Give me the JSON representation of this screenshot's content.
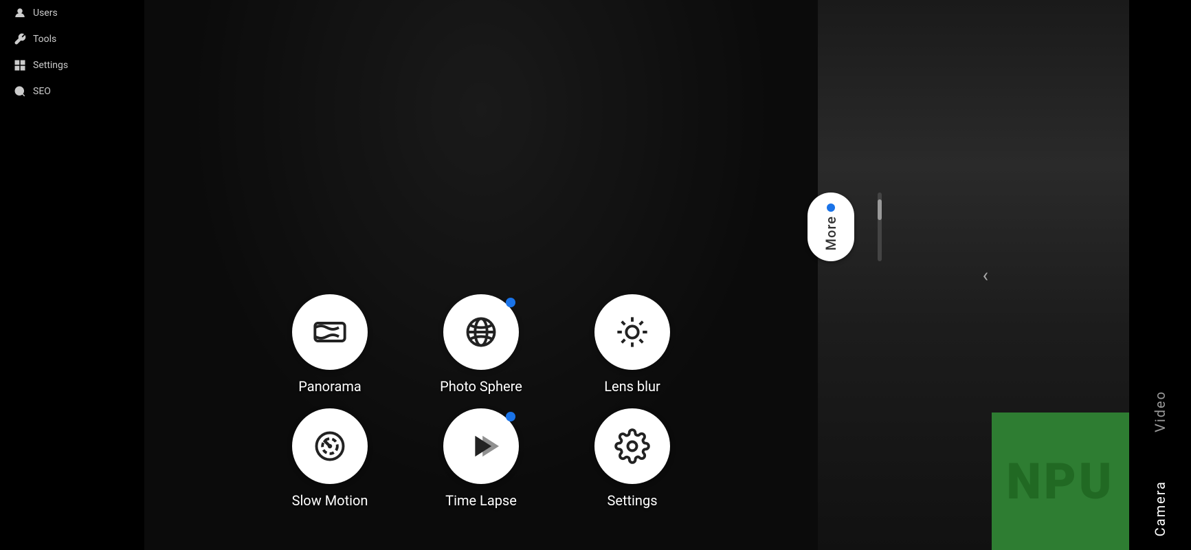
{
  "sidebar": {
    "items": [
      {
        "id": "users",
        "label": "Users",
        "icon": "person-icon"
      },
      {
        "id": "tools",
        "label": "Tools",
        "icon": "wrench-icon"
      },
      {
        "id": "settings",
        "label": "Settings",
        "icon": "settings-icon"
      },
      {
        "id": "seo",
        "label": "SEO",
        "icon": "seo-icon"
      }
    ]
  },
  "camera_modes": {
    "row1": [
      {
        "id": "panorama",
        "label": "Panorama",
        "has_dot": false
      },
      {
        "id": "photo_sphere",
        "label": "Photo Sphere",
        "has_dot": true
      },
      {
        "id": "lens_blur",
        "label": "Lens blur",
        "has_dot": false
      }
    ],
    "row2": [
      {
        "id": "slow_motion",
        "label": "Slow Motion",
        "has_dot": false
      },
      {
        "id": "time_lapse",
        "label": "Time Lapse",
        "has_dot": true
      },
      {
        "id": "settings",
        "label": "Settings",
        "has_dot": false
      }
    ]
  },
  "more_button": {
    "label": "More",
    "dot_color": "#1a73e8"
  },
  "right_labels": [
    {
      "id": "video",
      "label": "Video"
    },
    {
      "id": "camera",
      "label": "Camera"
    }
  ],
  "npu": {
    "label": "NPU"
  },
  "back_chevron": "<",
  "colors": {
    "dot_blue": "#1a73e8",
    "bg_dark": "#000000",
    "icon_fill": "#222222",
    "label_white": "#ffffff",
    "pill_bg": "#ffffff",
    "npu_bg": "#2e7d32"
  }
}
